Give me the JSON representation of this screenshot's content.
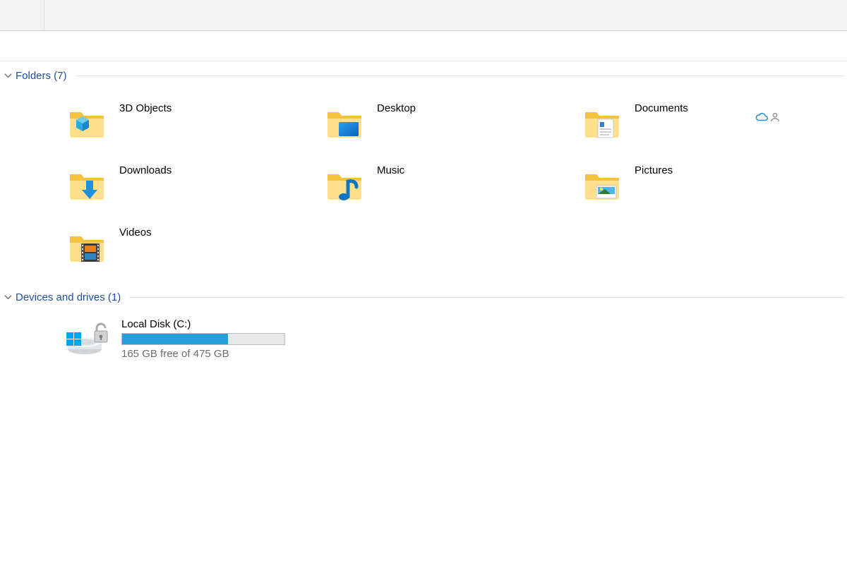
{
  "sections": {
    "folders": {
      "label": "Folders (7)",
      "items": [
        {
          "name": "3D Objects",
          "icon": "3d"
        },
        {
          "name": "Desktop",
          "icon": "desktop"
        },
        {
          "name": "Documents",
          "icon": "documents",
          "sync": true
        },
        {
          "name": "Downloads",
          "icon": "downloads"
        },
        {
          "name": "Music",
          "icon": "music"
        },
        {
          "name": "Pictures",
          "icon": "pictures"
        },
        {
          "name": "Videos",
          "icon": "videos"
        }
      ]
    },
    "drives": {
      "label": "Devices and drives (1)",
      "items": [
        {
          "name": "Local Disk (C:)",
          "subtext": "165 GB free of 475 GB",
          "used_pct": 65
        }
      ]
    }
  }
}
